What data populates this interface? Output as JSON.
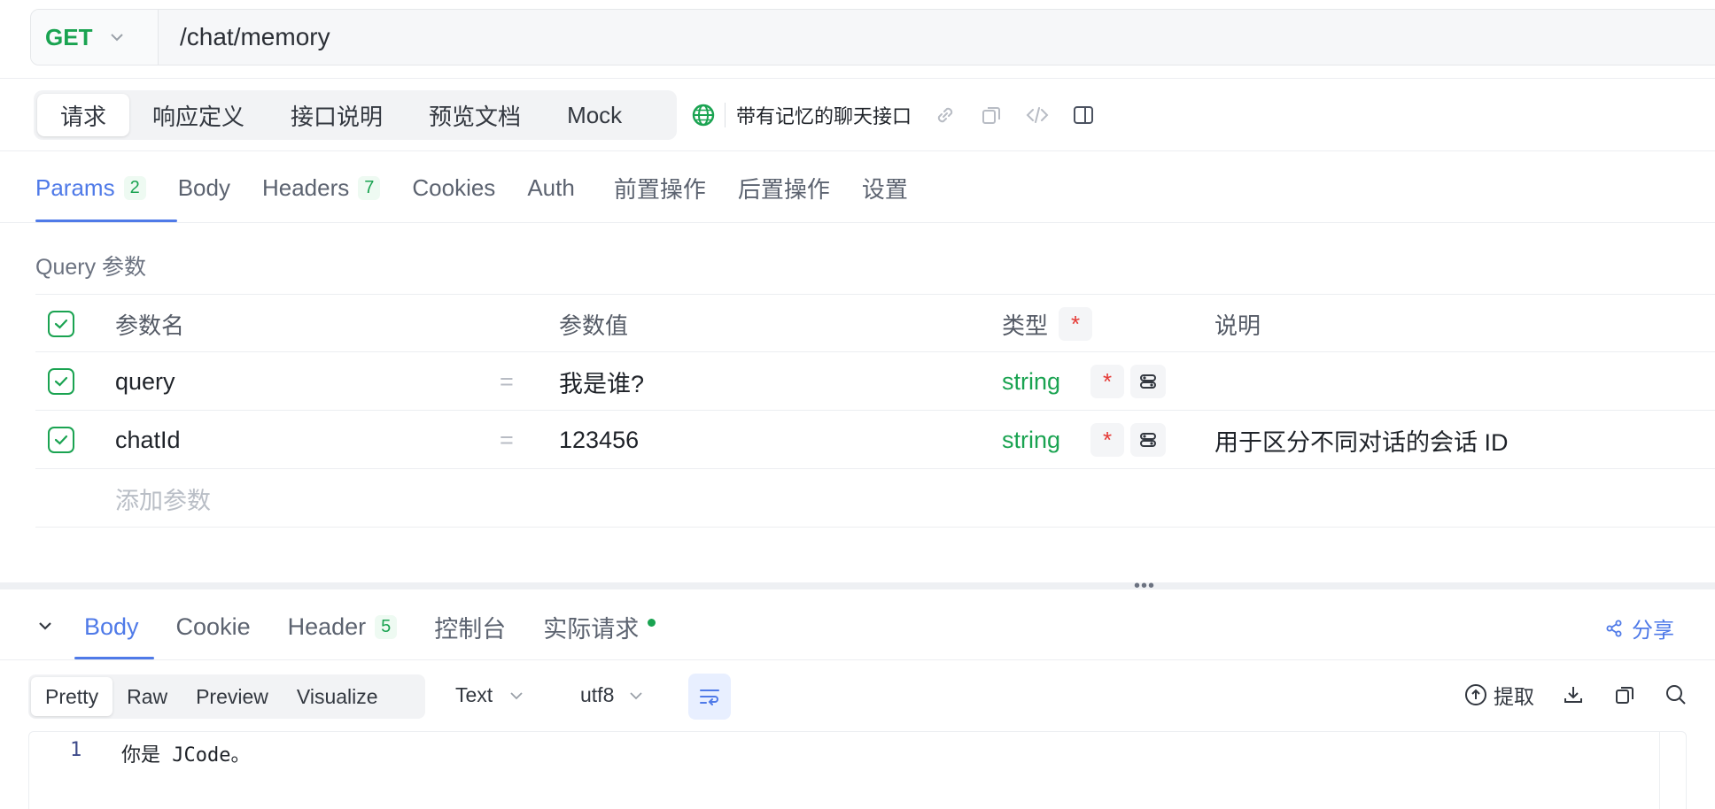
{
  "request": {
    "method": "GET",
    "url": "/chat/memory"
  },
  "main_tabs": [
    {
      "label": "请求",
      "active": true
    },
    {
      "label": "响应定义",
      "active": false
    },
    {
      "label": "接口说明",
      "active": false
    },
    {
      "label": "预览文档",
      "active": false
    },
    {
      "label": "Mock",
      "active": false
    }
  ],
  "api": {
    "title": "带有记忆的聊天接口",
    "icons": [
      "globe-icon",
      "link-icon",
      "copy-icon",
      "code-icon",
      "panel-icon"
    ]
  },
  "sub_tabs": [
    {
      "label": "Params",
      "count": "2",
      "active": true
    },
    {
      "label": "Body"
    },
    {
      "label": "Headers",
      "count": "7"
    },
    {
      "label": "Cookies"
    },
    {
      "label": "Auth"
    },
    {
      "label": "前置操作"
    },
    {
      "label": "后置操作"
    },
    {
      "label": "设置"
    }
  ],
  "query": {
    "section_label": "Query 参数",
    "headers": {
      "name": "参数名",
      "value": "参数值",
      "type": "类型",
      "required": "*",
      "desc": "说明"
    },
    "rows": [
      {
        "name": "query",
        "eq": "=",
        "value": "我是谁?",
        "type": "string",
        "required": "*",
        "desc": ""
      },
      {
        "name": "chatId",
        "eq": "=",
        "value": "123456",
        "type": "string",
        "required": "*",
        "desc": "用于区分不同对话的会话 ID"
      }
    ],
    "add_placeholder": "添加参数"
  },
  "response": {
    "tabs": [
      {
        "label": "Body",
        "active": true
      },
      {
        "label": "Cookie"
      },
      {
        "label": "Header",
        "count": "5"
      },
      {
        "label": "控制台"
      },
      {
        "label": "实际请求",
        "dot": true
      }
    ],
    "share_label": "分享",
    "view_modes": [
      {
        "label": "Pretty",
        "active": true
      },
      {
        "label": "Raw"
      },
      {
        "label": "Preview"
      },
      {
        "label": "Visualize"
      }
    ],
    "format": "Text",
    "encoding": "utf8",
    "extract_label": "提取",
    "body_lines": [
      {
        "no": "1",
        "text": "你是 JCode。"
      }
    ]
  },
  "colors": {
    "accent": "#4f7ae8",
    "green": "#1aa351",
    "required": "#e53935"
  }
}
